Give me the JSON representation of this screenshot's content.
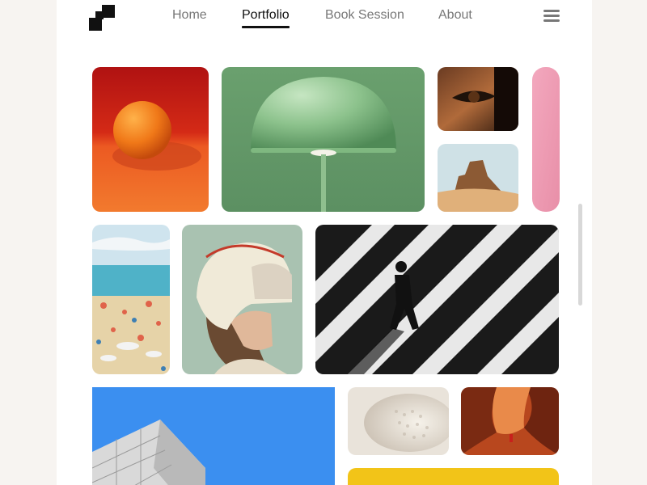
{
  "brand": {
    "logo_icon": "checker-squares-logo"
  },
  "nav": {
    "items": [
      {
        "label": "Home",
        "active": false
      },
      {
        "label": "Portfolio",
        "active": true
      },
      {
        "label": "Book Session",
        "active": false
      },
      {
        "label": "About",
        "active": false
      }
    ],
    "menu_icon": "hamburger-menu-icon"
  },
  "gallery": {
    "tiles": [
      {
        "subject": "orange-fruit-photo"
      },
      {
        "subject": "green-dome-lamp-photo"
      },
      {
        "subject": "eye-closeup-photo"
      },
      {
        "subject": "desert-butte-photo"
      },
      {
        "subject": "pink-blur-photo"
      },
      {
        "subject": "crowded-beach-photo"
      },
      {
        "subject": "helmet-woman-portrait-photo"
      },
      {
        "subject": "striped-shadow-walker-photo"
      },
      {
        "subject": "building-corner-blue-sky-photo"
      },
      {
        "subject": "white-texture-closeup-photo"
      },
      {
        "subject": "red-canyon-photo"
      },
      {
        "subject": "yellow-block-photo"
      }
    ]
  },
  "colors": {
    "accent_text": "#111111",
    "nav_text": "#777777",
    "page_bg": "#ffffff",
    "outer_bg": "#f7f4f1"
  }
}
